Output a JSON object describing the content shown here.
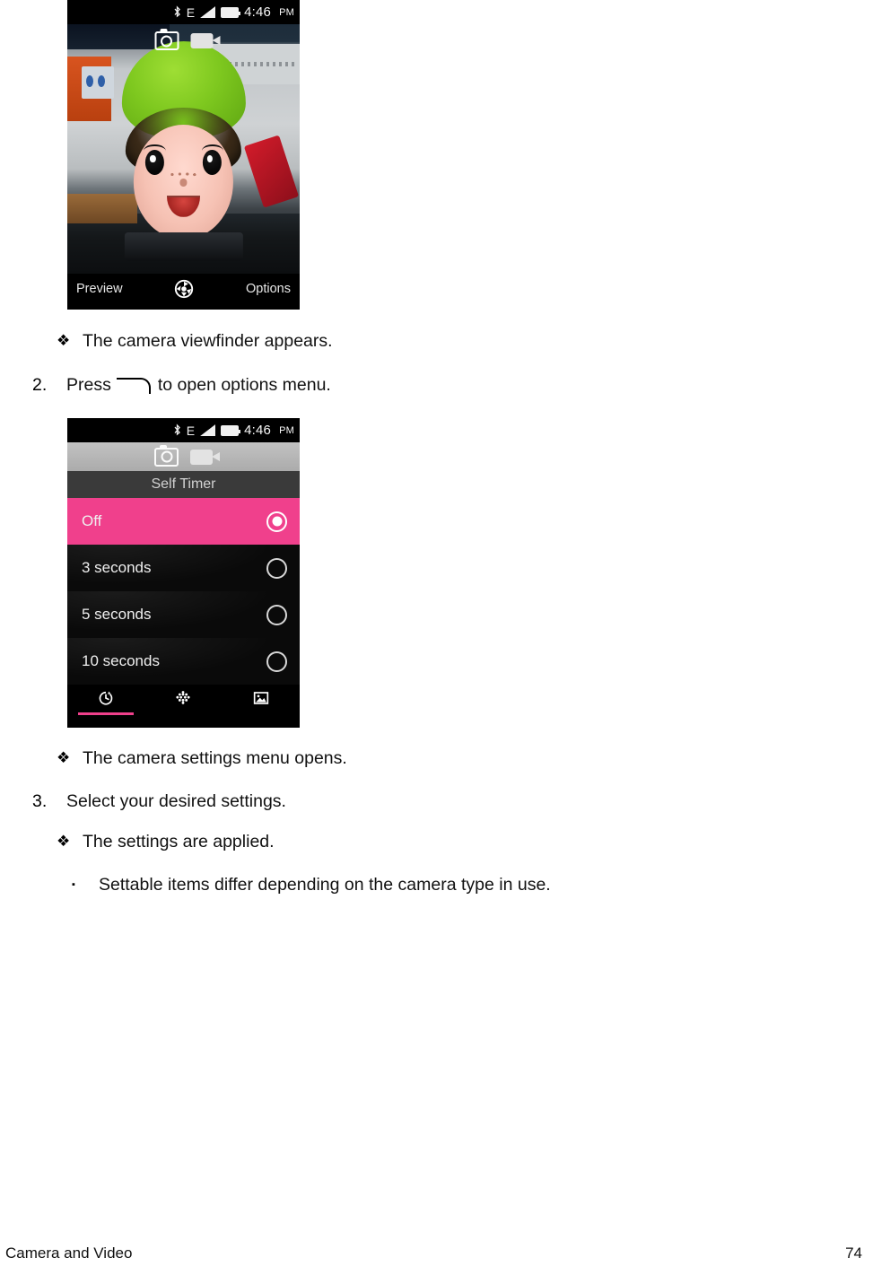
{
  "document": {
    "footer": {
      "section": "Camera and Video",
      "page_number": "74"
    }
  },
  "screenshot_viewfinder": {
    "status_bar": {
      "bluetooth_icon": "bluetooth-icon",
      "network_label": "E",
      "signal_icon": "signal-bars-icon",
      "battery_icon": "battery-icon",
      "time": "4:46",
      "ampm": "PM"
    },
    "overlay": {
      "camera_mode_icon": "camera-icon",
      "video_mode_icon": "video-camera-icon"
    },
    "bottom_bar": {
      "left_label": "Preview",
      "shutter_icon": "shutter-aperture-icon",
      "right_label": "Options"
    }
  },
  "screenshot_settings": {
    "status_bar": {
      "bluetooth_icon": "bluetooth-icon",
      "network_label": "E",
      "signal_icon": "signal-bars-icon",
      "battery_icon": "battery-icon",
      "time": "4:46",
      "ampm": "PM"
    },
    "mode_toggle": {
      "camera_icon": "camera-icon",
      "video_icon": "video-camera-icon"
    },
    "menu_title": "Self Timer",
    "options": [
      {
        "label": "Off",
        "selected": true
      },
      {
        "label": "3 seconds",
        "selected": false
      },
      {
        "label": "5 seconds",
        "selected": false
      },
      {
        "label": "10 seconds",
        "selected": false
      }
    ],
    "tabs": [
      {
        "icon": "self-timer-icon",
        "active": true
      },
      {
        "icon": "effects-grid-icon",
        "active": false
      },
      {
        "icon": "scene-image-icon",
        "active": false
      }
    ],
    "accent_color": "#f0408c"
  },
  "body_text": {
    "bullet_viewfinder": "The camera viewfinder appears.",
    "step2_number": "2.",
    "step2_before_key": "Press",
    "step2_after_key": "to open options menu.",
    "bullet_settings_menu": "The camera settings menu opens.",
    "step3_number": "3.",
    "step3_text": "Select your desired settings.",
    "bullet_settings_applied": "The settings are applied.",
    "note_settable_items": "Settable items differ depending on the camera type in use.",
    "diamond_bullet": "❖",
    "square_bullet": "▪"
  }
}
